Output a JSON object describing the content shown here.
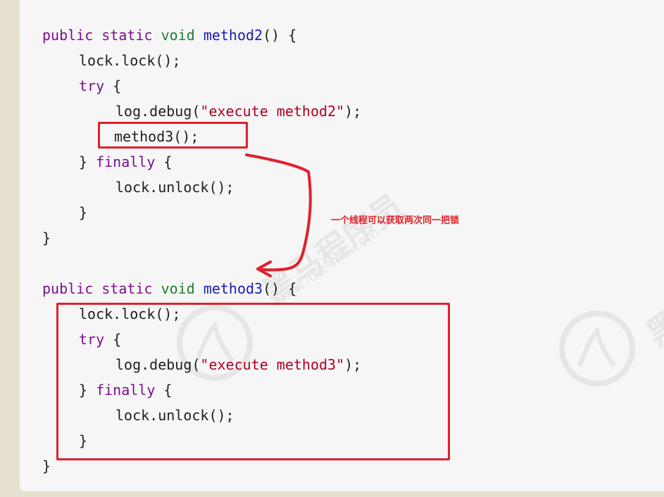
{
  "code": {
    "method2": {
      "sig_public": "public",
      "sig_static": "static",
      "sig_void": "void",
      "sig_name": "method2",
      "sig_rest": "() {",
      "lock": "lock.lock();",
      "try_kw": "try",
      "try_brace": " {",
      "log_prefix": "log.debug(",
      "log_string": "\"execute method2\"",
      "log_suffix": ");",
      "call": "method3();",
      "finally_close": "} ",
      "finally_kw": "finally",
      "finally_brace": " {",
      "unlock": "lock.unlock();",
      "inner_close": "}",
      "close": "}"
    },
    "method3": {
      "sig_public": "public",
      "sig_static": "static",
      "sig_void": "void",
      "sig_name": "method3",
      "sig_rest": "() {",
      "lock": "lock.lock();",
      "try_kw": "try",
      "try_brace": " {",
      "log_prefix": "log.debug(",
      "log_string": "\"execute method3\"",
      "log_suffix": ");",
      "finally_close": "} ",
      "finally_kw": "finally",
      "finally_brace": " {",
      "unlock": "lock.unlock();",
      "inner_close": "}",
      "close": "}"
    }
  },
  "annotation": {
    "label": "一个线程可以获取两次同一把锁",
    "color": "#e0202a"
  },
  "watermark": {
    "brand": "黑马程序员",
    "url": "www.itheima.com",
    "brand_short": "黑"
  },
  "colors": {
    "keyword": "#7b0f8f",
    "type": "#1d7f2e",
    "function": "#1a1ab2",
    "string": "#b00020",
    "background": "#f6f6f6",
    "frame": "#e6e0cf"
  }
}
